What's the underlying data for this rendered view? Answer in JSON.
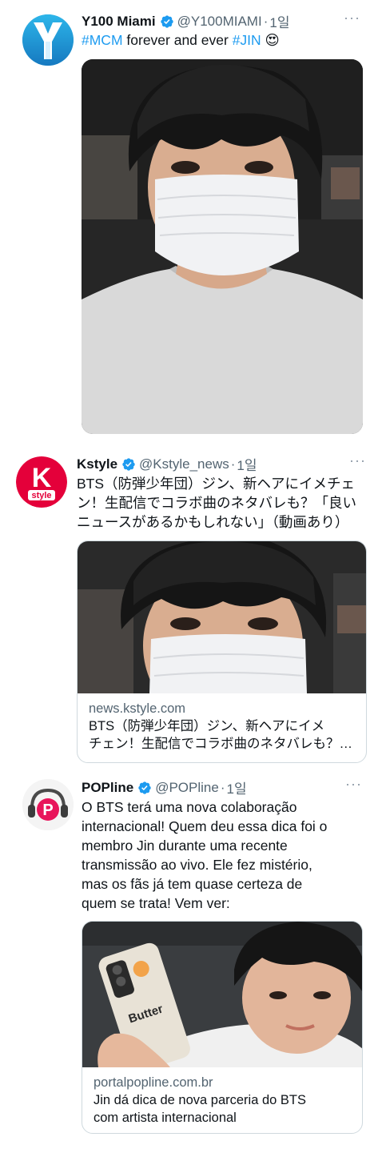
{
  "tweets": [
    {
      "name": "Y100 Miami",
      "handle": "@Y100MIAMI",
      "time": "1일",
      "text_parts": [
        "#MCM",
        " forever and ever ",
        "#JIN",
        " 😍"
      ],
      "avatar_letter": "Y",
      "more": "···"
    },
    {
      "name": "Kstyle",
      "handle": "@Kstyle_news",
      "time": "1일",
      "text_lines": [
        "BTS（防弾少年団）ジン、新ヘアにイメチェ",
        "ン！生配信でコラボ曲のネタバレも？「良い",
        "ニュースがあるかもしれない」（動画あり）"
      ],
      "avatar_letter": "K",
      "avatar_sub": "style",
      "card": {
        "domain": "news.kstyle.com",
        "title_lines": [
          "BTS（防弾少年団）ジン、新ヘアにイメ",
          "チェン！生配信でコラボ曲のネタバレも？…"
        ]
      },
      "more": "···"
    },
    {
      "name": "POPline",
      "handle": "@POPline",
      "time": "1일",
      "text_lines": [
        "O BTS terá uma nova colaboração",
        "internacional! Quem deu essa dica foi o",
        "membro Jin durante uma recente",
        "transmissão ao vivo. Ele fez mistério,",
        "mas os fãs já tem quase certeza de",
        "quem se trata! Vem ver:"
      ],
      "avatar_letter": "P",
      "card": {
        "domain": "portalpopline.com.br",
        "title_lines": [
          "Jin dá dica de nova parceria do BTS",
          "com artista internacional"
        ],
        "phone_case_text": "Butter"
      },
      "more": "···"
    }
  ],
  "colors": {
    "verified": "#1d9bf0",
    "link": "#1d9bf0",
    "secondary": "#536471",
    "kstyle_red": "#e4003a",
    "popline_pink": "#e8155b"
  },
  "icons": [
    "verified-badge-icon",
    "more-options-icon"
  ]
}
